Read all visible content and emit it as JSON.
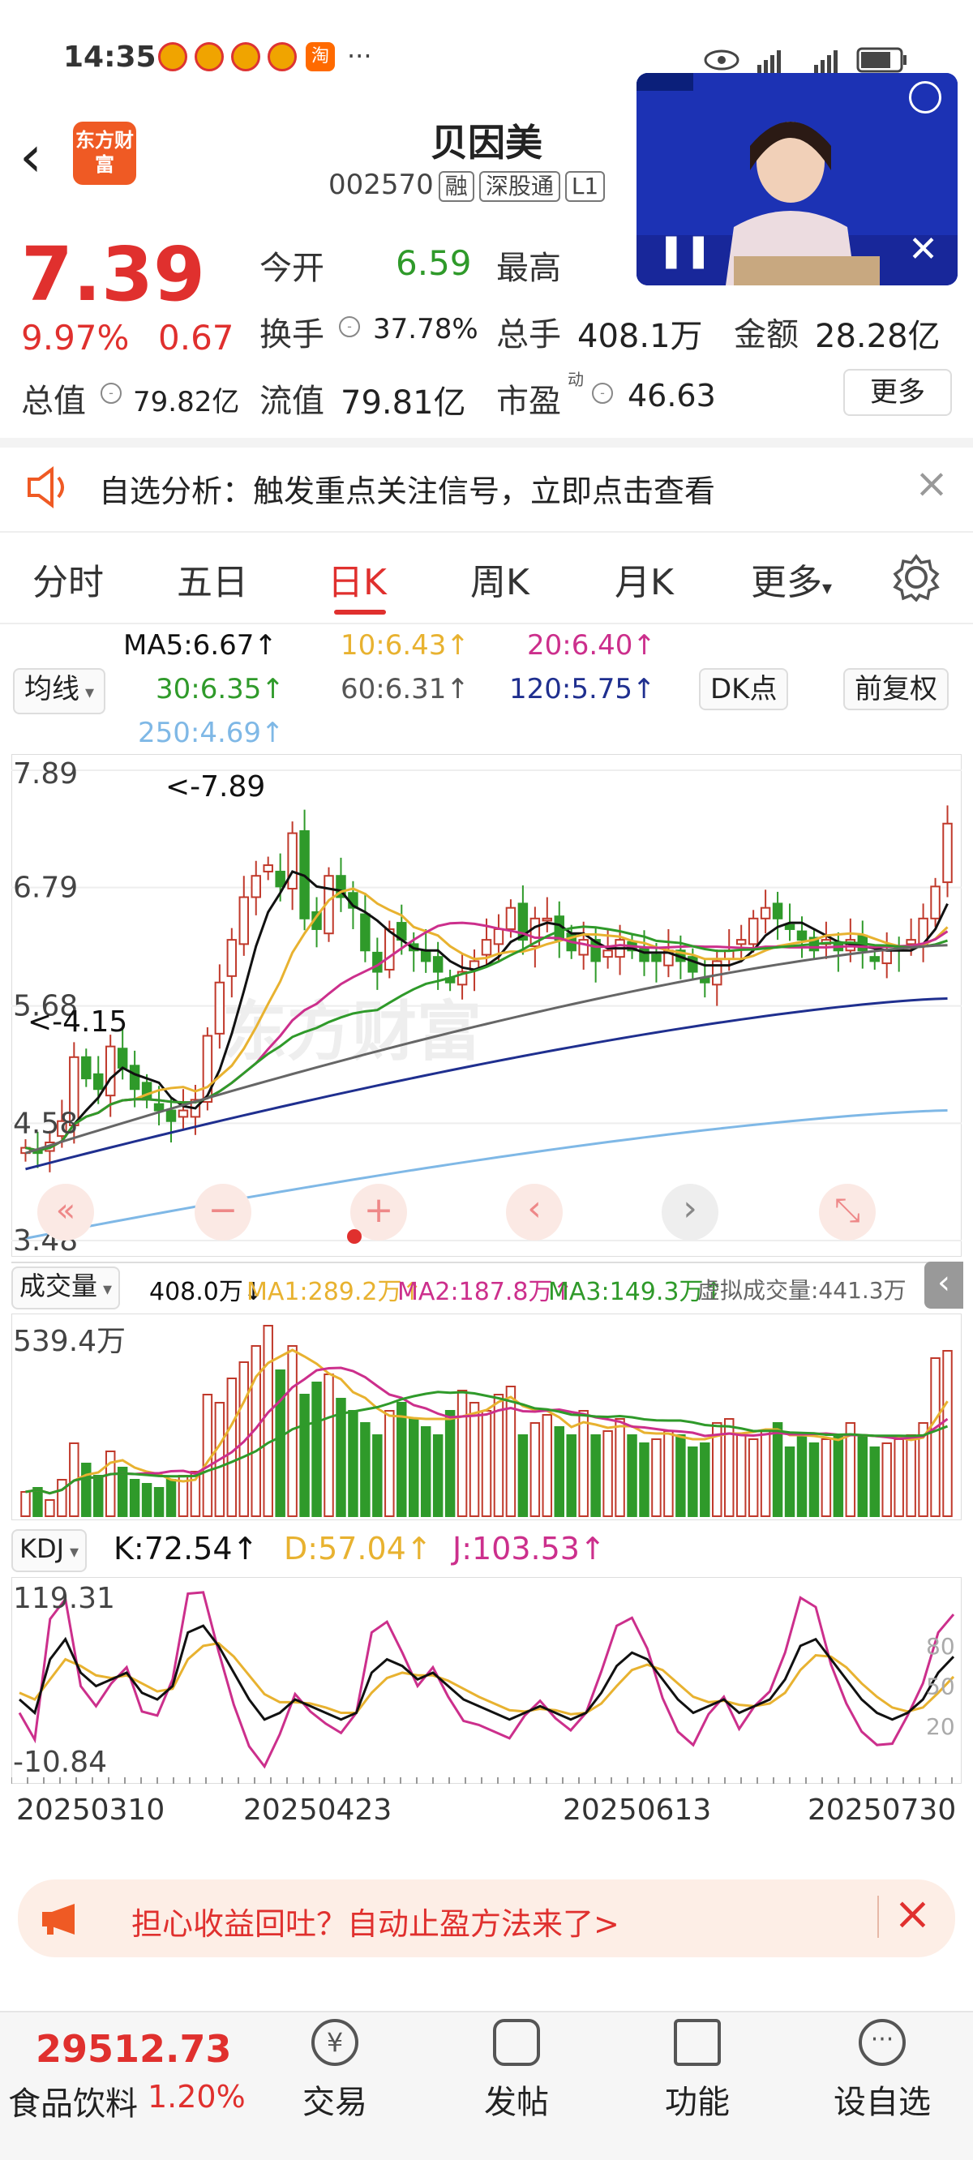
{
  "status": {
    "time": "14:35",
    "more": "···",
    "taobao_glyph": "淘"
  },
  "header": {
    "back": "‹",
    "logo": "东方财富",
    "title": "贝因美",
    "code": "002570",
    "tags": [
      "融",
      "深股通",
      "L1"
    ]
  },
  "quote": {
    "price": "7.39",
    "pct": "9.97%",
    "change": "0.67",
    "open_label": "今开",
    "open": "6.59",
    "high_label": "最高",
    "turnover_label": "换手",
    "turnover": "37.78%",
    "volume_label": "总手",
    "volume": "408.1万",
    "amount_label": "金额",
    "amount": "28.28亿",
    "mcap_label": "总值",
    "mcap": "79.82亿",
    "float_label": "流值",
    "float": "79.81亿",
    "pe_label": "市盈",
    "pe_sup": "动",
    "pe": "46.63",
    "more_btn": "更多"
  },
  "notice": {
    "text": "自选分析：触发重点关注信号，立即点击查看",
    "close": "×"
  },
  "tabs": [
    "分时",
    "五日",
    "日K",
    "周K",
    "月K",
    "更多"
  ],
  "ma_legend": {
    "ma5": "MA5:6.67↑",
    "ma10": "10:6.43↑",
    "ma20": "20:6.40↑",
    "ma30": "30:6.35↑",
    "ma60": "60:6.31↑",
    "ma120": "120:5.75↑",
    "ma250": "250:4.69↑",
    "btn_ma": "均线",
    "btn_dk": "DK点",
    "btn_adj": "前复权"
  },
  "chart_data": [
    {
      "type": "candlestick",
      "title": "日K",
      "y_ticks": [
        "7.89",
        "6.79",
        "5.68",
        "4.58",
        "3.48"
      ],
      "ylim": [
        3.48,
        7.89
      ],
      "max_label": "<-7.89",
      "min_label": "<-4.15",
      "x_ticks": [
        "20250310",
        "20250423",
        "20250613",
        "20250730"
      ],
      "series": [
        {
          "name": "MA5",
          "color": "#111111"
        },
        {
          "name": "MA10",
          "color": "#e8b230"
        },
        {
          "name": "MA20",
          "color": "#cc2f8c"
        },
        {
          "name": "MA30",
          "color": "#2f9a2a"
        },
        {
          "name": "MA60",
          "color": "#666666"
        },
        {
          "name": "MA120",
          "color": "#1f2f8f"
        },
        {
          "name": "MA250",
          "color": "#7fb8e6"
        }
      ],
      "close": [
        4.35,
        4.3,
        4.4,
        4.6,
        5.2,
        5.0,
        4.9,
        5.3,
        5.1,
        4.9,
        4.8,
        4.7,
        4.6,
        4.7,
        4.8,
        5.4,
        5.9,
        6.3,
        6.7,
        6.9,
        7.0,
        6.8,
        7.3,
        6.5,
        6.4,
        6.9,
        6.7,
        6.6,
        6.2,
        6.0,
        6.4,
        6.3,
        6.2,
        6.1,
        6.0,
        5.9,
        6.0,
        6.1,
        6.3,
        6.4,
        6.6,
        6.3,
        6.5,
        6.5,
        6.3,
        6.2,
        6.3,
        6.1,
        6.2,
        6.3,
        6.2,
        6.1,
        6.1,
        6.2,
        6.1,
        6.0,
        5.9,
        6.1,
        6.2,
        6.3,
        6.5,
        6.6,
        6.5,
        6.4,
        6.3,
        6.2,
        6.3,
        6.2,
        6.3,
        6.2,
        6.1,
        6.2,
        6.2,
        6.3,
        6.5,
        6.8,
        7.39
      ]
    },
    {
      "type": "bar",
      "title": "成交量",
      "header": {
        "label": "成交量",
        "value": "408.0万↓",
        "ma1": "MA1:289.2万↑",
        "ma2": "MA2:187.8万↑",
        "ma3": "MA3:149.3万↑",
        "virtual": "虚拟成交量:441.3万"
      },
      "y_ticks": [
        "539.4万"
      ],
      "values": [
        60,
        70,
        40,
        90,
        180,
        130,
        100,
        160,
        120,
        90,
        80,
        70,
        90,
        100,
        110,
        300,
        280,
        340,
        380,
        420,
        470,
        360,
        420,
        300,
        330,
        350,
        290,
        260,
        230,
        200,
        260,
        280,
        240,
        220,
        200,
        260,
        310,
        280,
        260,
        300,
        320,
        200,
        230,
        250,
        220,
        200,
        260,
        200,
        210,
        240,
        200,
        180,
        190,
        210,
        200,
        170,
        180,
        230,
        240,
        200,
        190,
        210,
        230,
        170,
        200,
        180,
        190,
        200,
        230,
        200,
        170,
        180,
        190,
        200,
        230,
        390,
        408
      ]
    },
    {
      "type": "line",
      "title": "KDJ",
      "header": {
        "label": "KDJ",
        "k": "K:72.54↑",
        "d": "D:57.04↑",
        "j": "J:103.53↑"
      },
      "y_ticks": [
        "119.31",
        "-10.84"
      ],
      "ylim": [
        -10.84,
        119.31
      ],
      "levels": [
        "80",
        "50",
        "20"
      ],
      "series": [
        {
          "name": "K",
          "color": "#111111",
          "values": [
            40,
            30,
            70,
            85,
            60,
            50,
            55,
            60,
            45,
            40,
            50,
            90,
            95,
            80,
            60,
            40,
            25,
            30,
            40,
            35,
            30,
            25,
            30,
            60,
            70,
            65,
            55,
            60,
            50,
            40,
            35,
            30,
            25,
            30,
            35,
            30,
            25,
            30,
            45,
            65,
            75,
            70,
            55,
            40,
            30,
            35,
            40,
            30,
            35,
            40,
            55,
            80,
            85,
            70,
            55,
            40,
            30,
            25,
            30,
            40,
            60,
            72
          ]
        },
        {
          "name": "D",
          "color": "#e8b230",
          "values": [
            45,
            40,
            55,
            70,
            65,
            58,
            56,
            58,
            52,
            46,
            48,
            70,
            80,
            82,
            72,
            58,
            44,
            38,
            38,
            37,
            34,
            30,
            30,
            45,
            56,
            60,
            58,
            58,
            54,
            48,
            42,
            37,
            32,
            31,
            33,
            32,
            29,
            30,
            37,
            50,
            62,
            66,
            62,
            52,
            42,
            38,
            39,
            36,
            35,
            37,
            45,
            62,
            73,
            72,
            64,
            52,
            42,
            34,
            31,
            34,
            45,
            57
          ]
        },
        {
          "name": "J",
          "color": "#cc2f8c",
          "values": [
            30,
            10,
            100,
            115,
            50,
            35,
            52,
            64,
            31,
            28,
            55,
            119,
            120,
            76,
            36,
            5,
            -10,
            14,
            44,
            31,
            22,
            15,
            30,
            90,
            98,
            75,
            50,
            64,
            42,
            24,
            21,
            16,
            11,
            28,
            39,
            26,
            17,
            30,
            61,
            95,
            101,
            78,
            41,
            16,
            6,
            29,
            42,
            18,
            35,
            46,
            75,
            116,
            109,
            66,
            37,
            16,
            6,
            7,
            28,
            52,
            90,
            103.53
          ]
        }
      ]
    }
  ],
  "chart_controls": [
    "«",
    "−",
    "+",
    "‹",
    "›",
    "⤡"
  ],
  "banner": {
    "text": "担心收益回吐？自动止盈方法来了>",
    "close": "×"
  },
  "bottom_nav": {
    "index_value": "29512.73",
    "index_name": "食品饮料",
    "index_pct": "1.20%",
    "items": [
      "交易",
      "发帖",
      "功能",
      "设自选"
    ]
  },
  "colors": {
    "up": "#e0302e",
    "down": "#2f9a2a",
    "accent": "#e0302e"
  }
}
